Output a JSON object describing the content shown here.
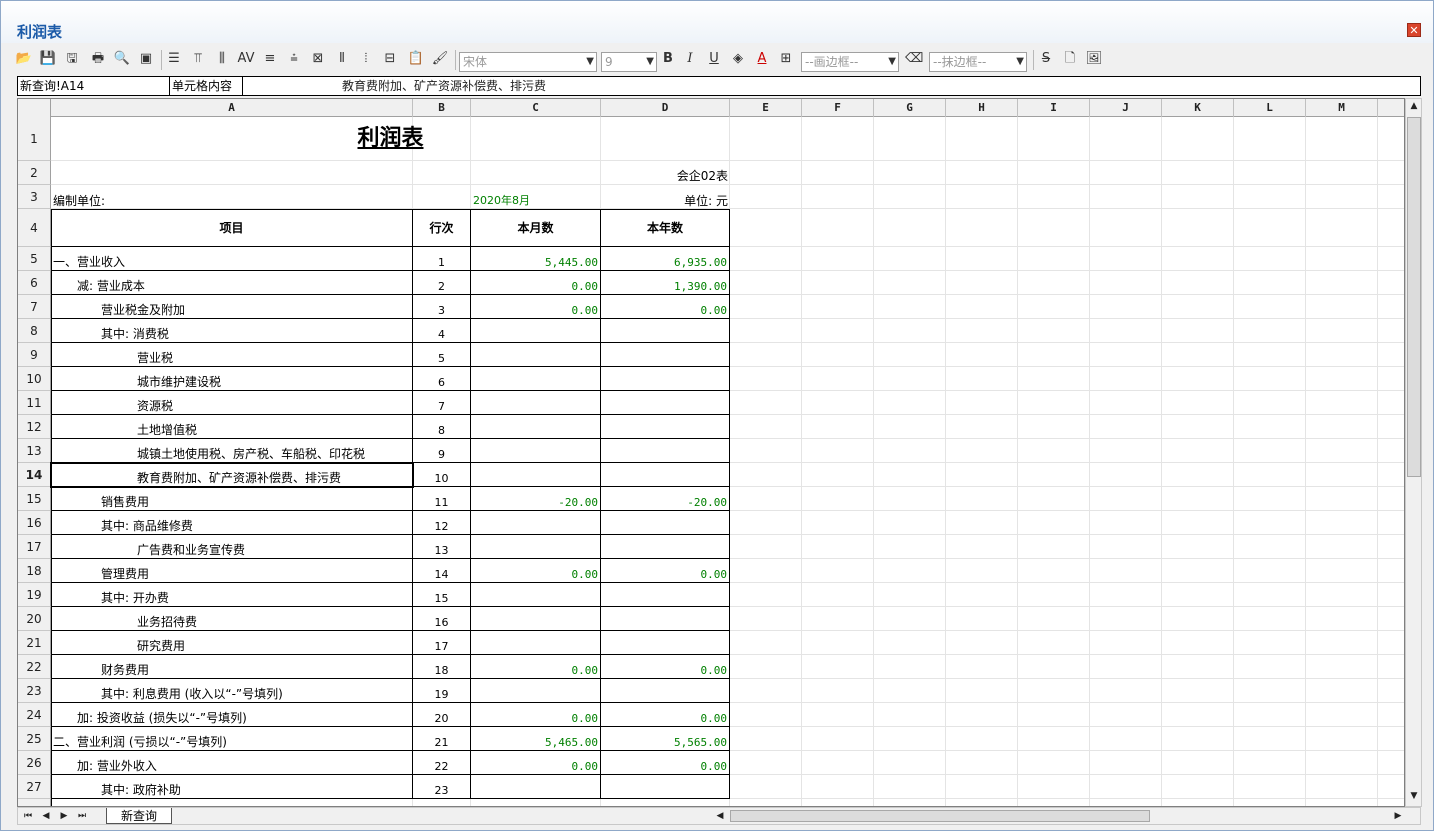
{
  "window": {
    "title": "利润表"
  },
  "toolbar": {
    "font_name": "宋体",
    "font_size": "9",
    "bold_label": "B",
    "italic_label": "I",
    "underline_label": "U",
    "draw_border_placeholder": "--画边框--",
    "erase_border_placeholder": "--抹边框--"
  },
  "formula_bar": {
    "cell_ref": "新查询!A14",
    "label": "单元格内容",
    "content": "教育费附加、矿产资源补偿费、排污费"
  },
  "columns": [
    "A",
    "B",
    "C",
    "D",
    "E",
    "F",
    "G",
    "H",
    "I",
    "J",
    "K",
    "L",
    "M"
  ],
  "sheet": {
    "title": "利润表",
    "form_code": "会企02表",
    "unit_label": "编制单位:",
    "period": "2020年8月",
    "currency": "单位: 元",
    "headers": {
      "item": "项目",
      "line": "行次",
      "month": "本月数",
      "year": "本年数"
    },
    "rows": [
      {
        "row": "5",
        "item": "一、营业收入",
        "indent": 0,
        "line": "1",
        "month": "5,445.00",
        "year": "6,935.00"
      },
      {
        "row": "6",
        "item": "减: 营业成本",
        "indent": 1,
        "line": "2",
        "month": "0.00",
        "year": "1,390.00"
      },
      {
        "row": "7",
        "item": "营业税金及附加",
        "indent": 2,
        "line": "3",
        "month": "0.00",
        "year": "0.00"
      },
      {
        "row": "8",
        "item": "其中: 消费税",
        "indent": 2,
        "line": "4",
        "month": "",
        "year": ""
      },
      {
        "row": "9",
        "item": "营业税",
        "indent": 3,
        "line": "5",
        "month": "",
        "year": ""
      },
      {
        "row": "10",
        "item": "城市维护建设税",
        "indent": 3,
        "line": "6",
        "month": "",
        "year": ""
      },
      {
        "row": "11",
        "item": "资源税",
        "indent": 3,
        "line": "7",
        "month": "",
        "year": ""
      },
      {
        "row": "12",
        "item": "土地增值税",
        "indent": 3,
        "line": "8",
        "month": "",
        "year": ""
      },
      {
        "row": "13",
        "item": "城镇土地使用税、房产税、车船税、印花税",
        "indent": 3,
        "line": "9",
        "month": "",
        "year": ""
      },
      {
        "row": "14",
        "item": "教育费附加、矿产资源补偿费、排污费",
        "indent": 3,
        "line": "10",
        "month": "",
        "year": ""
      },
      {
        "row": "15",
        "item": "销售费用",
        "indent": 2,
        "line": "11",
        "month": "-20.00",
        "year": "-20.00"
      },
      {
        "row": "16",
        "item": "其中: 商品维修费",
        "indent": 2,
        "line": "12",
        "month": "",
        "year": ""
      },
      {
        "row": "17",
        "item": "广告费和业务宣传费",
        "indent": 3,
        "line": "13",
        "month": "",
        "year": ""
      },
      {
        "row": "18",
        "item": "管理费用",
        "indent": 2,
        "line": "14",
        "month": "0.00",
        "year": "0.00"
      },
      {
        "row": "19",
        "item": "其中: 开办费",
        "indent": 2,
        "line": "15",
        "month": "",
        "year": ""
      },
      {
        "row": "20",
        "item": "业务招待费",
        "indent": 3,
        "line": "16",
        "month": "",
        "year": ""
      },
      {
        "row": "21",
        "item": "研究费用",
        "indent": 3,
        "line": "17",
        "month": "",
        "year": ""
      },
      {
        "row": "22",
        "item": "财务费用",
        "indent": 2,
        "line": "18",
        "month": "0.00",
        "year": "0.00"
      },
      {
        "row": "23",
        "item": "其中: 利息费用 (收入以“-”号填列)",
        "indent": 2,
        "line": "19",
        "month": "",
        "year": ""
      },
      {
        "row": "24",
        "item": "加: 投资收益 (损失以“-”号填列)",
        "indent": 1,
        "line": "20",
        "month": "0.00",
        "year": "0.00"
      },
      {
        "row": "25",
        "item": "二、营业利润 (亏损以“-”号填列)",
        "indent": 0,
        "line": "21",
        "month": "5,465.00",
        "year": "5,565.00"
      },
      {
        "row": "26",
        "item": "加: 营业外收入",
        "indent": 1,
        "line": "22",
        "month": "0.00",
        "year": "0.00"
      },
      {
        "row": "27",
        "item": "其中: 政府补助",
        "indent": 2,
        "line": "23",
        "month": "",
        "year": ""
      }
    ]
  },
  "sheet_tabs": {
    "active": "新查询"
  },
  "colors": {
    "accent": "#1b5aa8",
    "number": "#008000"
  }
}
